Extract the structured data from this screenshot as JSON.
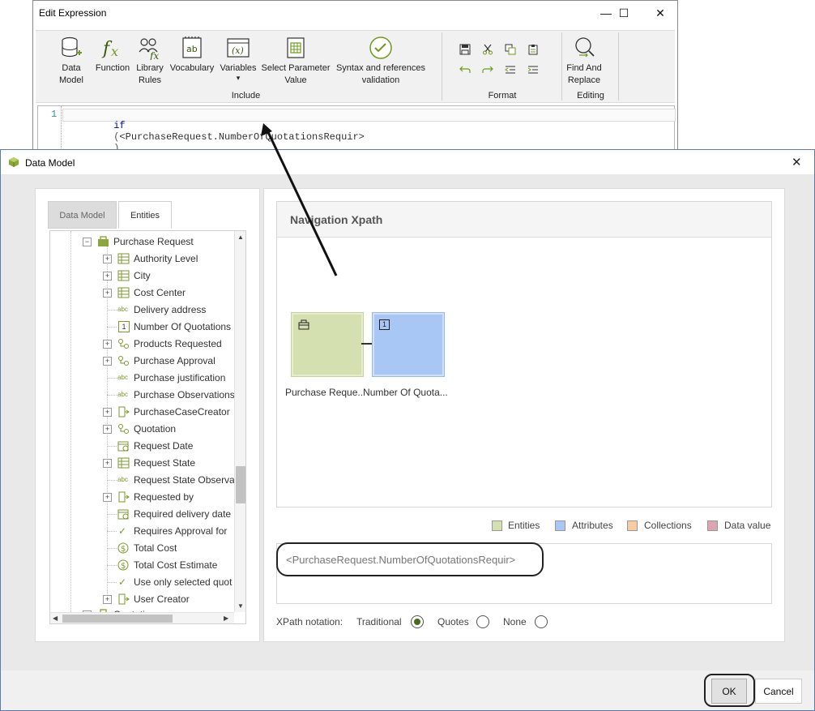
{
  "edit_expression": {
    "title": "Edit Expression",
    "window_controls": {
      "minimize": "—",
      "maximize": "☐",
      "close": "✕"
    },
    "ribbon": {
      "buttons": [
        {
          "label": "Data\nModel",
          "icon": "database-icon"
        },
        {
          "label": "Function",
          "icon": "function-icon"
        },
        {
          "label": "Library\nRules",
          "icon": "library-rules-icon"
        },
        {
          "label": "Vocabulary",
          "icon": "vocabulary-icon"
        },
        {
          "label": "Variables",
          "icon": "variables-icon"
        },
        {
          "label": "Select Parameter\nValue",
          "icon": "select-parameter-icon"
        },
        {
          "label": "Syntax and references\nvalidation",
          "icon": "validation-icon"
        }
      ],
      "variables_dropdown": "▾",
      "groups": {
        "include": "Include",
        "format": "Format",
        "editing": "Editing"
      },
      "find_replace": "Find And\nReplace"
    },
    "editor": {
      "line_number": "1",
      "keyword": "if",
      "paren_open": "(",
      "token": "<PurchaseRequest.NumberOfQuotationsRequir>",
      "paren_close": ")"
    }
  },
  "data_model": {
    "title": "Data Model",
    "close": "✕",
    "tabs": [
      "Data Model",
      "Entities"
    ],
    "tree": {
      "root": "Purchase Request",
      "items": [
        "Authority Level",
        "City",
        "Cost Center",
        "Delivery address",
        "Number Of Quotations",
        "Products Requested",
        "Purchase Approval",
        "Purchase justification",
        "Purchase Observations",
        "PurchaseCaseCreator",
        "Quotation",
        "Request Date",
        "Request State",
        "Request State Observa",
        "Requested by",
        "Required delivery date",
        "Requires Approval for",
        "Total Cost",
        "Total Cost Estimate",
        "Use only selected quot",
        "User Creator"
      ],
      "next_root": "Quotation",
      "number_icon_text": "1"
    },
    "navigation": {
      "title": "Navigation Xpath",
      "node_label": "Purchase Reque..Number Of Quota...",
      "number_icon_text": "1"
    },
    "legend": [
      {
        "label": "Entities",
        "color": "#d5e0b0"
      },
      {
        "label": "Attributes",
        "color": "#a9c7f5"
      },
      {
        "label": "Collections",
        "color": "#f7cca3"
      },
      {
        "label": "Data value",
        "color": "#dfa4b4"
      }
    ],
    "colors": {
      "entity_node": "#d5e0b0",
      "attribute_node": "#a9c7f5",
      "accent_green": "#8aa83a",
      "radio_selected": "#4a6b16"
    },
    "xpath_value": "<PurchaseRequest.NumberOfQuotationsRequir>",
    "xpath_notation": {
      "label": "XPath notation:",
      "options": [
        "Traditional",
        "Quotes",
        "None"
      ],
      "selected": "Traditional"
    },
    "buttons": {
      "ok": "OK",
      "cancel": "Cancel"
    }
  }
}
